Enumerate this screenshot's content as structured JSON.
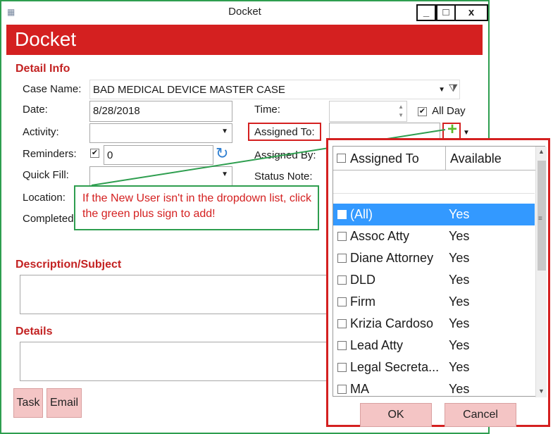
{
  "window": {
    "title": "Docket",
    "minimize": "_",
    "maximize": "□",
    "close": "x"
  },
  "header": {
    "title": "Docket"
  },
  "sections": {
    "detail_info": "Detail Info",
    "description": "Description/Subject",
    "details": "Details"
  },
  "fields": {
    "case_name": {
      "label": "Case Name:",
      "value": "BAD MEDICAL DEVICE MASTER CASE"
    },
    "date": {
      "label": "Date:",
      "value": "8/28/2018"
    },
    "time": {
      "label": "Time:",
      "value": ""
    },
    "all_day": {
      "label": "All Day",
      "checked": true
    },
    "activity": {
      "label": "Activity:",
      "value": ""
    },
    "assigned_to": {
      "label": "Assigned To:",
      "value": ""
    },
    "reminders": {
      "label": "Reminders:",
      "checked": true,
      "value": "0"
    },
    "assigned_by": {
      "label": "Assigned By:"
    },
    "quick_fill": {
      "label": "Quick Fill:",
      "value": ""
    },
    "status_note": {
      "label": "Status Note:"
    },
    "location": {
      "label": "Location:"
    },
    "completed": {
      "label": "Completed:"
    }
  },
  "callout": {
    "text": "If the New User isn't in the dropdown list, click the green plus sign to add!"
  },
  "dropdown": {
    "columns": {
      "assigned_to": "Assigned To",
      "available": "Available"
    },
    "items": [
      {
        "name": "(All)",
        "available": "Yes",
        "selected": true
      },
      {
        "name": "Assoc Atty",
        "available": "Yes"
      },
      {
        "name": "Diane Attorney",
        "available": "Yes"
      },
      {
        "name": "DLD",
        "available": "Yes"
      },
      {
        "name": "Firm",
        "available": "Yes"
      },
      {
        "name": "Krizia Cardoso",
        "available": "Yes"
      },
      {
        "name": "Lead Atty",
        "available": "Yes"
      },
      {
        "name": "Legal Secreta...",
        "available": "Yes"
      },
      {
        "name": "MA",
        "available": "Yes"
      }
    ],
    "ok_label": "OK",
    "cancel_label": "Cancel"
  },
  "buttons": {
    "task": "Task",
    "email": "Email"
  },
  "colors": {
    "accent_red": "#d42020",
    "callout_green": "#2e9e4f",
    "selection_blue": "#3399ff",
    "button_pink": "#f4c5c5"
  }
}
